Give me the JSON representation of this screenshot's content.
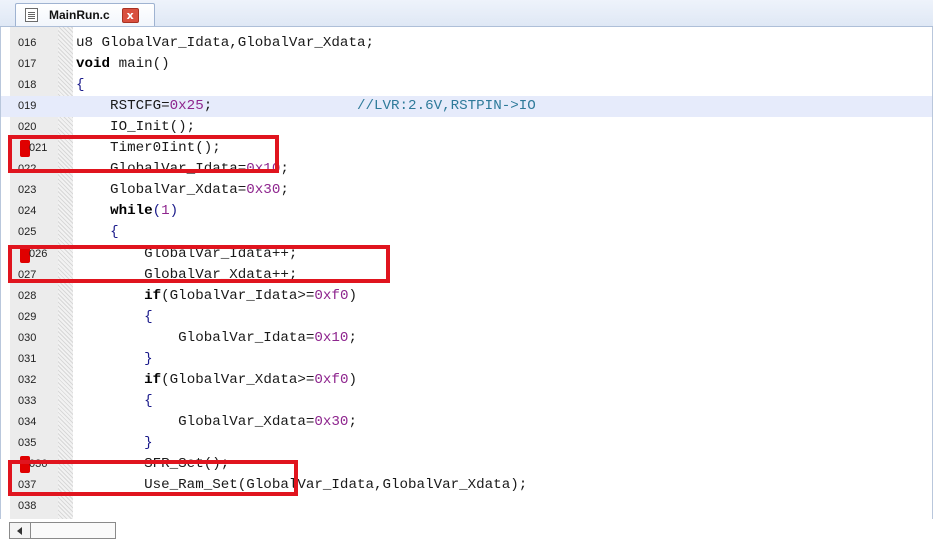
{
  "tab": {
    "label": "MainRun.c",
    "close_glyph": "x"
  },
  "colors": {
    "breakpoint": "#e00000",
    "annotation_box": "#e0141e",
    "highlight_line": "#e6ebfb"
  },
  "lines": [
    {
      "num": "016",
      "tokens": [
        {
          "t": "u8 GlobalVar_Idata,GlobalVar_Xdata;"
        }
      ]
    },
    {
      "num": "017",
      "tokens": [
        {
          "t": "void",
          "c": "kw"
        },
        {
          "t": " main()"
        }
      ]
    },
    {
      "num": "018",
      "tokens": [
        {
          "t": "{",
          "c": "pn"
        }
      ]
    },
    {
      "num": "019",
      "highlight": true,
      "tokens": [
        {
          "t": "    RSTCFG="
        },
        {
          "t": "0x25",
          "c": "num"
        },
        {
          "t": ";                 "
        },
        {
          "t": "//LVR:2.6V,RSTPIN->IO",
          "c": "cm"
        }
      ]
    },
    {
      "num": "020",
      "tokens": [
        {
          "t": "    IO_Init();"
        }
      ]
    },
    {
      "num": "021",
      "breakpoint": true,
      "tokens": [
        {
          "t": "    Timer0Iint();"
        }
      ]
    },
    {
      "num": "022",
      "tokens": [
        {
          "t": "    GlobalVar_Idata="
        },
        {
          "t": "0x10",
          "c": "num"
        },
        {
          "t": ";"
        }
      ]
    },
    {
      "num": "023",
      "tokens": [
        {
          "t": "    GlobalVar_Xdata="
        },
        {
          "t": "0x30",
          "c": "num"
        },
        {
          "t": ";"
        }
      ]
    },
    {
      "num": "024",
      "tokens": [
        {
          "t": "    "
        },
        {
          "t": "while",
          "c": "kw"
        },
        {
          "t": "(",
          "c": "pn"
        },
        {
          "t": "1",
          "c": "num"
        },
        {
          "t": ")",
          "c": "pn"
        }
      ]
    },
    {
      "num": "025",
      "tokens": [
        {
          "t": "    "
        },
        {
          "t": "{",
          "c": "pn"
        }
      ]
    },
    {
      "num": "026",
      "breakpoint": true,
      "tokens": [
        {
          "t": "        GlobalVar_Idata++;"
        }
      ]
    },
    {
      "num": "027",
      "tokens": [
        {
          "t": "        GlobalVar_Xdata++;"
        }
      ]
    },
    {
      "num": "028",
      "tokens": [
        {
          "t": "        "
        },
        {
          "t": "if",
          "c": "kw"
        },
        {
          "t": "(GlobalVar_Idata>="
        },
        {
          "t": "0xf0",
          "c": "num"
        },
        {
          "t": ")"
        }
      ]
    },
    {
      "num": "029",
      "tokens": [
        {
          "t": "        "
        },
        {
          "t": "{",
          "c": "pn"
        }
      ]
    },
    {
      "num": "030",
      "tokens": [
        {
          "t": "            GlobalVar_Idata="
        },
        {
          "t": "0x10",
          "c": "num"
        },
        {
          "t": ";"
        }
      ]
    },
    {
      "num": "031",
      "tokens": [
        {
          "t": "        "
        },
        {
          "t": "}",
          "c": "pn"
        }
      ]
    },
    {
      "num": "032",
      "tokens": [
        {
          "t": "        "
        },
        {
          "t": "if",
          "c": "kw"
        },
        {
          "t": "(GlobalVar_Xdata>="
        },
        {
          "t": "0xf0",
          "c": "num"
        },
        {
          "t": ")"
        }
      ]
    },
    {
      "num": "033",
      "tokens": [
        {
          "t": "        "
        },
        {
          "t": "{",
          "c": "pn"
        }
      ]
    },
    {
      "num": "034",
      "tokens": [
        {
          "t": "            GlobalVar_Xdata="
        },
        {
          "t": "0x30",
          "c": "num"
        },
        {
          "t": ";"
        }
      ]
    },
    {
      "num": "035",
      "tokens": [
        {
          "t": "        "
        },
        {
          "t": "}",
          "c": "pn"
        }
      ]
    },
    {
      "num": "036",
      "breakpoint": true,
      "tokens": [
        {
          "t": "        SFR_Set();"
        }
      ]
    },
    {
      "num": "037",
      "tokens": [
        {
          "t": "        Use_Ram_Set(GlobalVar_Idata,GlobalVar_Xdata);"
        }
      ]
    },
    {
      "num": "038",
      "tokens": [
        {
          "t": ""
        }
      ]
    }
  ]
}
